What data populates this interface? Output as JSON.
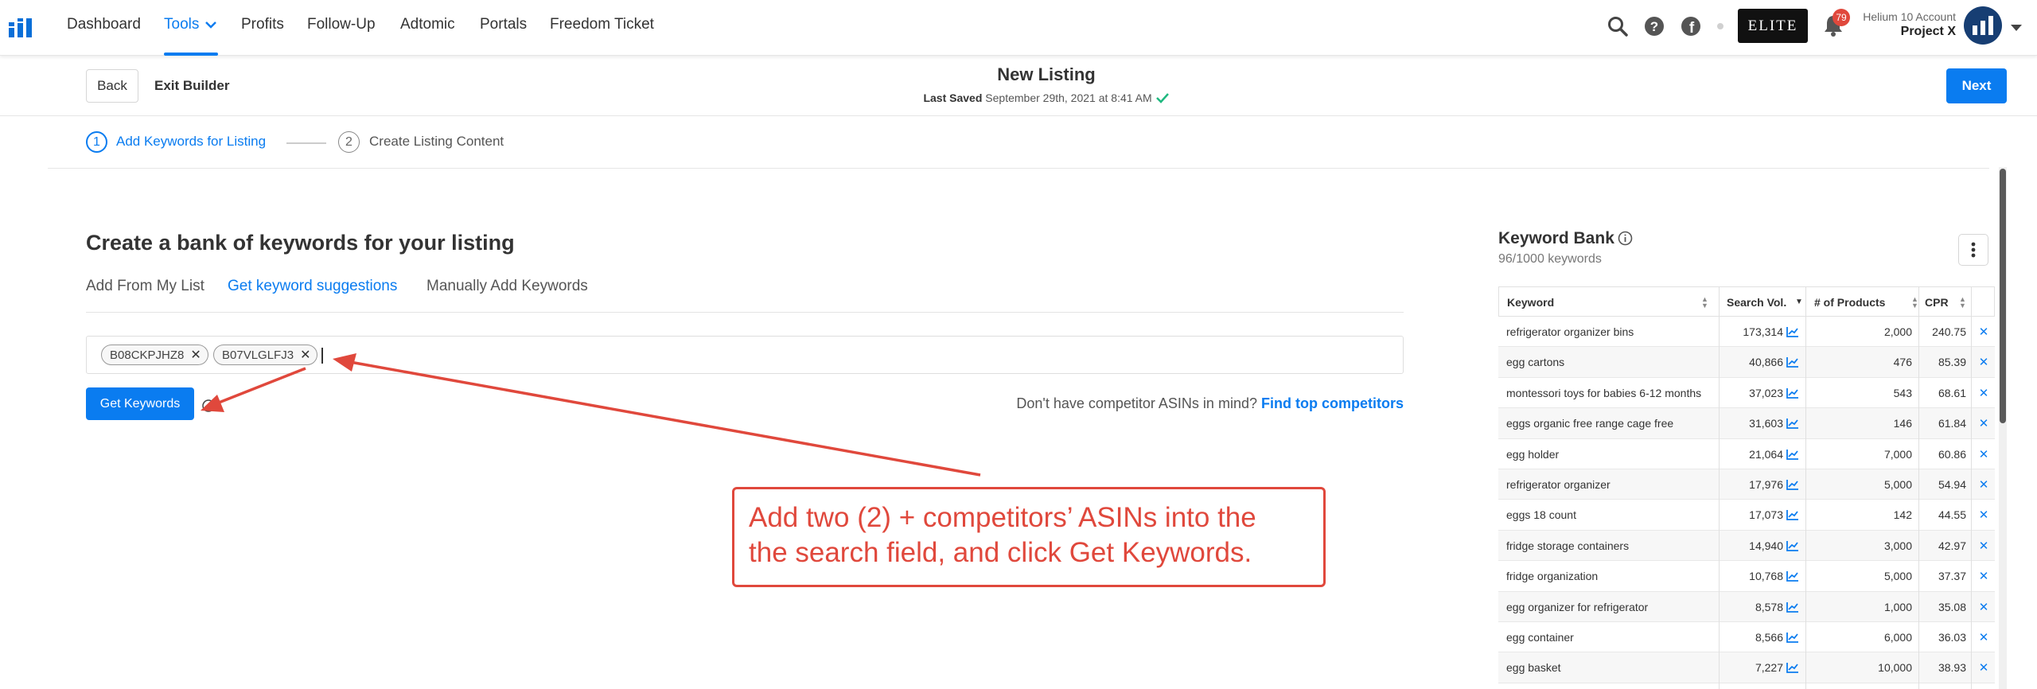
{
  "nav": {
    "items": [
      "Dashboard",
      "Tools",
      "Profits",
      "Follow-Up",
      "Adtomic",
      "Portals",
      "Freedom Ticket"
    ],
    "notifications_count": "79",
    "elite_label": "ELITE",
    "account_label": "Helium 10 Account",
    "account_name": "Project X"
  },
  "header": {
    "back_label": "Back",
    "exit_label": "Exit Builder",
    "title": "New Listing",
    "last_saved_label": "Last Saved",
    "last_saved_value": "September 29th, 2021 at 8:41 AM",
    "next_label": "Next"
  },
  "steps": [
    {
      "number": "1",
      "label": "Add Keywords for Listing"
    },
    {
      "number": "2",
      "label": "Create Listing Content"
    }
  ],
  "main": {
    "heading": "Create a bank of keywords for your listing",
    "tabs": [
      "Add From My List",
      "Get keyword suggestions",
      "Manually Add Keywords"
    ],
    "asins": [
      "B08CKPJHZ8",
      "B07VLGLFJ3"
    ],
    "get_keywords_label": "Get Keywords",
    "prompt_text": "Don't have competitor ASINs in mind?",
    "prompt_link": "Find top competitors"
  },
  "keyword_bank": {
    "title": "Keyword Bank",
    "count": "96/1000 keywords",
    "columns": [
      "Keyword",
      "Search Vol.",
      "# of Products",
      "CPR"
    ],
    "rows": [
      {
        "keyword": "refrigerator organizer bins",
        "volume": "173,314",
        "products": "2,000",
        "cpr": "240.75"
      },
      {
        "keyword": "egg cartons",
        "volume": "40,866",
        "products": "476",
        "cpr": "85.39"
      },
      {
        "keyword": "montessori toys for babies 6-12 months",
        "volume": "37,023",
        "products": "543",
        "cpr": "68.61"
      },
      {
        "keyword": "eggs organic free range cage free",
        "volume": "31,603",
        "products": "146",
        "cpr": "61.84"
      },
      {
        "keyword": "egg holder",
        "volume": "21,064",
        "products": "7,000",
        "cpr": "60.86"
      },
      {
        "keyword": "refrigerator organizer",
        "volume": "17,976",
        "products": "5,000",
        "cpr": "54.94"
      },
      {
        "keyword": "eggs 18 count",
        "volume": "17,073",
        "products": "142",
        "cpr": "44.55"
      },
      {
        "keyword": "fridge storage containers",
        "volume": "14,940",
        "products": "3,000",
        "cpr": "42.97"
      },
      {
        "keyword": "fridge organization",
        "volume": "10,768",
        "products": "5,000",
        "cpr": "37.37"
      },
      {
        "keyword": "egg organizer for refrigerator",
        "volume": "8,578",
        "products": "1,000",
        "cpr": "35.08"
      },
      {
        "keyword": "egg container",
        "volume": "8,566",
        "products": "6,000",
        "cpr": "36.03"
      },
      {
        "keyword": "egg basket",
        "volume": "7,227",
        "products": "10,000",
        "cpr": "38.93"
      }
    ]
  },
  "annotation": {
    "line1": "Add two (2) + competitors’ ASINs into the",
    "line2": "the search field, and click Get Keywords."
  },
  "colors": {
    "accent": "#0a7cf0",
    "annotation": "#e0483c",
    "elite_bg": "#111111"
  }
}
